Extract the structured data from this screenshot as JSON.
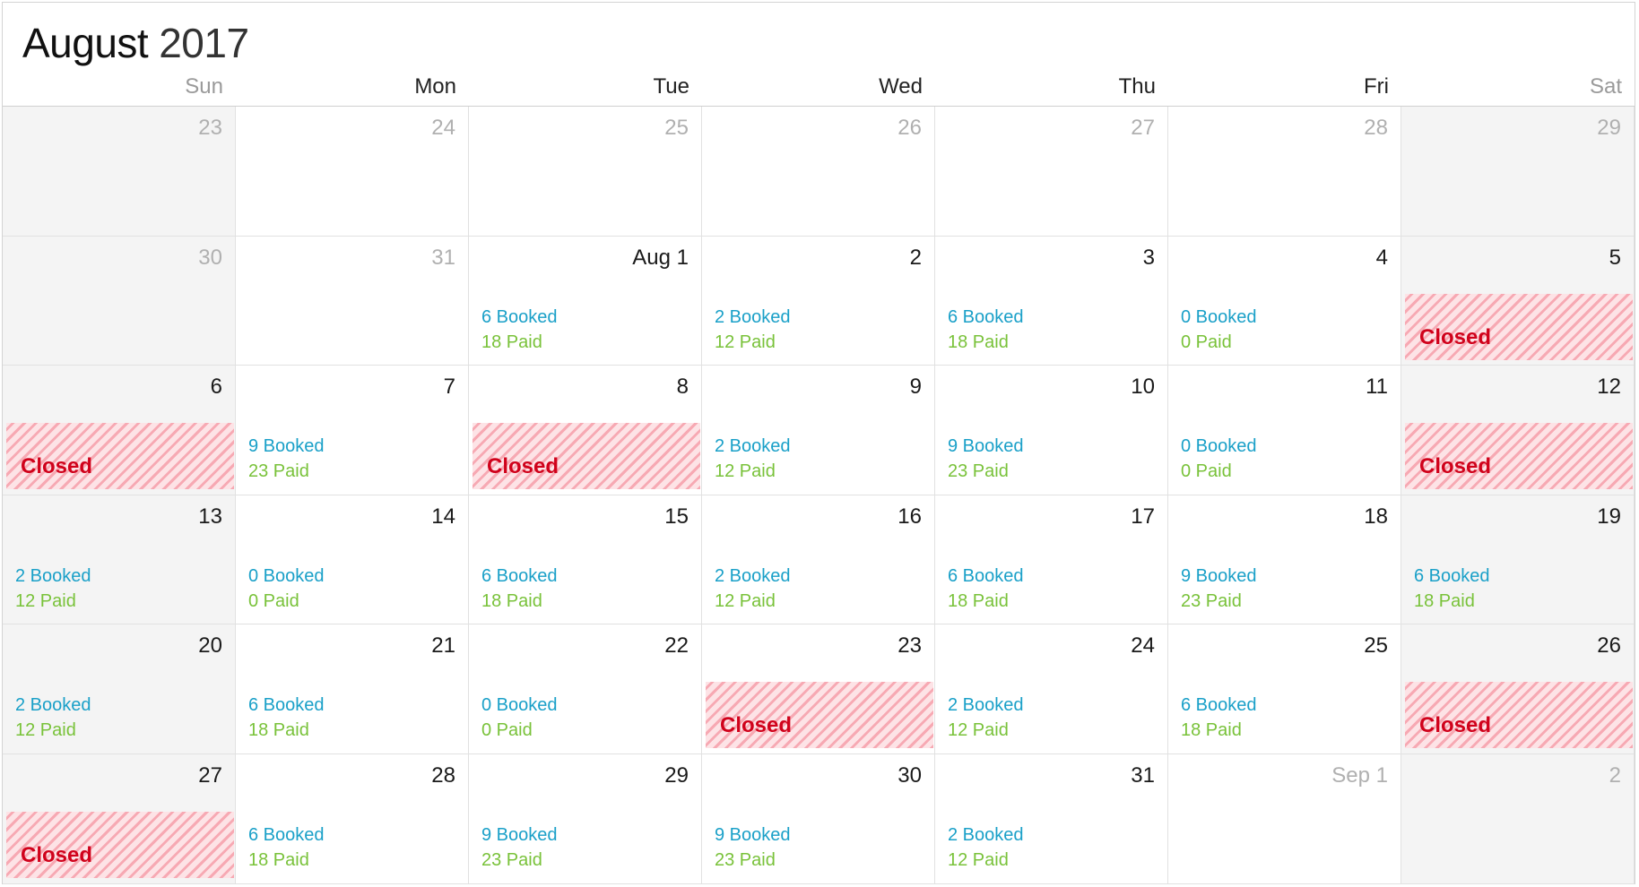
{
  "calendar": {
    "month": "August",
    "year": "2017",
    "weekdays": [
      "Sun",
      "Mon",
      "Tue",
      "Wed",
      "Thu",
      "Fri",
      "Sat"
    ],
    "colors": {
      "booked": "#1aa0c8",
      "paid": "#79c23a",
      "closed_text": "#d0021b",
      "closed_stripe": "#f7a9b3",
      "weekend_bg": "#f4f4f4"
    },
    "weeks": [
      [
        {
          "label": "23",
          "muted": true
        },
        {
          "label": "24",
          "muted": true
        },
        {
          "label": "25",
          "muted": true
        },
        {
          "label": "26",
          "muted": true
        },
        {
          "label": "27",
          "muted": true
        },
        {
          "label": "28",
          "muted": true
        },
        {
          "label": "29",
          "muted": true
        }
      ],
      [
        {
          "label": "30",
          "muted": true
        },
        {
          "label": "31",
          "muted": true
        },
        {
          "label": "Aug 1",
          "booked": "6 Booked",
          "paid": "18 Paid"
        },
        {
          "label": "2",
          "booked": "2 Booked",
          "paid": "12 Paid"
        },
        {
          "label": "3",
          "booked": "6 Booked",
          "paid": "18 Paid"
        },
        {
          "label": "4",
          "booked": "0 Booked",
          "paid": "0 Paid"
        },
        {
          "label": "5",
          "closed": "Closed"
        }
      ],
      [
        {
          "label": "6",
          "closed": "Closed"
        },
        {
          "label": "7",
          "booked": "9 Booked",
          "paid": "23 Paid"
        },
        {
          "label": "8",
          "closed": "Closed"
        },
        {
          "label": "9",
          "booked": "2 Booked",
          "paid": "12 Paid"
        },
        {
          "label": "10",
          "booked": "9 Booked",
          "paid": "23 Paid"
        },
        {
          "label": "11",
          "booked": "0 Booked",
          "paid": "0 Paid"
        },
        {
          "label": "12",
          "closed": "Closed"
        }
      ],
      [
        {
          "label": "13",
          "booked": "2 Booked",
          "paid": "12 Paid"
        },
        {
          "label": "14",
          "booked": "0 Booked",
          "paid": "0 Paid"
        },
        {
          "label": "15",
          "booked": "6 Booked",
          "paid": "18 Paid"
        },
        {
          "label": "16",
          "booked": "2 Booked",
          "paid": "12 Paid"
        },
        {
          "label": "17",
          "booked": "6 Booked",
          "paid": "18 Paid"
        },
        {
          "label": "18",
          "booked": "9 Booked",
          "paid": "23 Paid"
        },
        {
          "label": "19",
          "booked": "6 Booked",
          "paid": "18 Paid"
        }
      ],
      [
        {
          "label": "20",
          "booked": "2 Booked",
          "paid": "12 Paid"
        },
        {
          "label": "21",
          "booked": "6 Booked",
          "paid": "18 Paid"
        },
        {
          "label": "22",
          "booked": "0 Booked",
          "paid": "0 Paid"
        },
        {
          "label": "23",
          "closed": "Closed"
        },
        {
          "label": "24",
          "booked": "2 Booked",
          "paid": "12 Paid"
        },
        {
          "label": "25",
          "booked": "6 Booked",
          "paid": "18 Paid"
        },
        {
          "label": "26",
          "closed": "Closed"
        }
      ],
      [
        {
          "label": "27",
          "closed": "Closed"
        },
        {
          "label": "28",
          "booked": "6 Booked",
          "paid": "18 Paid"
        },
        {
          "label": "29",
          "booked": "9 Booked",
          "paid": "23 Paid"
        },
        {
          "label": "30",
          "booked": "9 Booked",
          "paid": "23 Paid"
        },
        {
          "label": "31",
          "booked": "2 Booked",
          "paid": "12 Paid"
        },
        {
          "label": "Sep 1",
          "muted": true
        },
        {
          "label": "2",
          "muted": true
        }
      ]
    ]
  }
}
